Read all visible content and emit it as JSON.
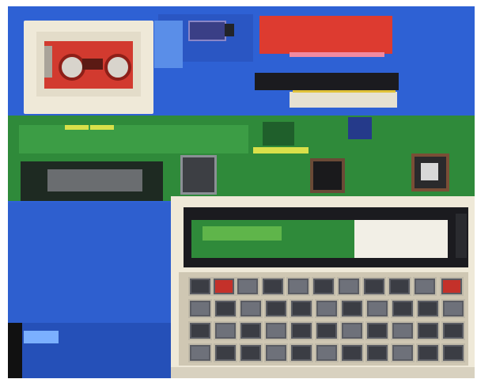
{
  "image": {
    "subject": "",
    "palette": {
      "background_blue": "#2f63d6",
      "deep_blue": "#1f3fae",
      "pcb_green": "#2f8a3a",
      "light_green": "#5fb54a",
      "cassette_red": "#d23a2f",
      "cream": "#efe9d8",
      "screen_dark": "#1b1b1f",
      "key_gray": "#3b3d44"
    }
  }
}
